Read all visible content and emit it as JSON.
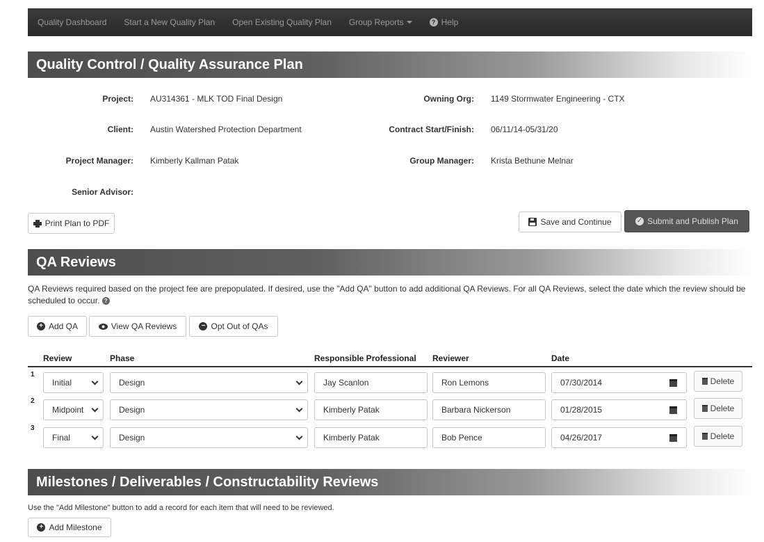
{
  "nav": {
    "items": [
      "Quality Dashboard",
      "Start a New Quality Plan",
      "Open Existing Quality Plan"
    ],
    "group_reports": "Group Reports",
    "help": "Help"
  },
  "plan_header": "Quality Control / Quality Assurance Plan",
  "project": {
    "project_label": "Project:",
    "project_value": "AU314361 - MLK TOD Final Design",
    "client_label": "Client:",
    "client_value": "Austin Watershed Protection Department",
    "pm_label": "Project Manager:",
    "pm_value": "Kimberly Kallman Patak",
    "advisor_label": "Senior Advisor:",
    "org_label": "Owning Org:",
    "org_value": "1149 Stormwater Engineering - CTX",
    "contract_label": "Contract Start/Finish:",
    "contract_value": "06/11/14-05/31/20",
    "gm_label": "Group Manager:",
    "gm_value": "Krista Bethune Melnar"
  },
  "actions": {
    "print": "Print Plan to PDF",
    "save": "Save and Continue",
    "submit": "Submit and Publish Plan"
  },
  "qa": {
    "header": "QA Reviews",
    "description": "QA Reviews required based on the project fee are prepopulated. If desired, use the \"Add QA\" button to add additional QA Reviews. For all QA Reviews, select the date which the review should be scheduled to occur.",
    "add_qa": "Add QA",
    "view_qa": "View QA Reviews",
    "opt_out": "Opt Out of QAs",
    "columns": {
      "review": "Review",
      "phase": "Phase",
      "responsible": "Responsible Professional",
      "reviewer": "Reviewer",
      "date": "Date"
    },
    "delete_label": "Delete",
    "rows": [
      {
        "num": "1",
        "review": "Initial",
        "phase": "Design",
        "responsible": "Jay Scanlon",
        "reviewer": "Ron Lemons",
        "date": "07/30/2014"
      },
      {
        "num": "2",
        "review": "Midpoint",
        "phase": "Design",
        "responsible": "Kimberly Patak",
        "reviewer": "Barbara Nickerson",
        "date": "01/28/2015"
      },
      {
        "num": "3",
        "review": "Final",
        "phase": "Design",
        "responsible": "Kimberly Patak",
        "reviewer": "Bob Pence",
        "date": "04/26/2017"
      }
    ]
  },
  "milestones": {
    "header": "Milestones / Deliverables / Constructability Reviews",
    "description": "Use the \"Add Milestone\" button to add a record for each item that will need to be reviewed.",
    "add": "Add Milestone"
  }
}
